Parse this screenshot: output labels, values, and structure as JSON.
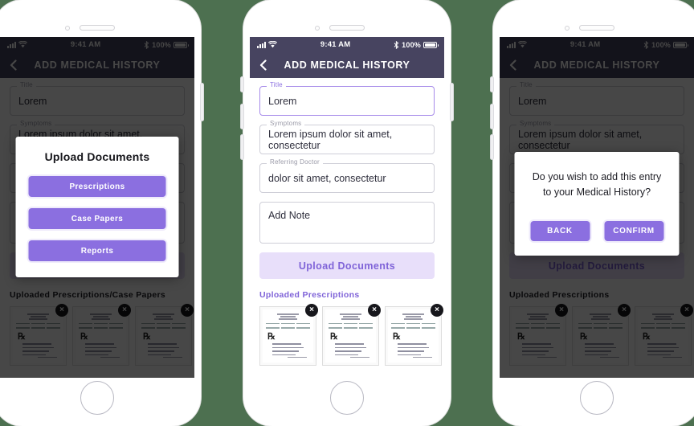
{
  "background_color": "#4d7050",
  "accent_purple": "#8b6fe0",
  "accent_light_purple": "#e8dffa",
  "navbar_color": "#474460",
  "status_bar": {
    "time": "9:41 AM",
    "battery_percent": "100%",
    "signal_icon": "signal-bars-icon",
    "wifi_icon": "wifi-icon",
    "bluetooth_icon": "bluetooth-icon",
    "battery_icon": "battery-icon"
  },
  "navbar": {
    "title": "ADD MEDICAL HISTORY",
    "back_icon": "back-chevron-icon"
  },
  "form": {
    "title_label": "Title",
    "title_value": "Lorem",
    "symptoms_label": "Symptoms",
    "symptoms_value": "Lorem ipsum dolor sit amet, consectetur",
    "referring_doctor_label": "Referring Doctor",
    "referring_doctor_value": "dolor sit amet, consectetur",
    "note_placeholder": "Add Note",
    "upload_button": "Upload Documents"
  },
  "sections": {
    "uploaded_prescriptions": "Uploaded Prescriptions",
    "uploaded_prescriptions_case_papers": "Uploaded Prescriptions/Case Papers"
  },
  "thumbnail": {
    "rx_symbol": "℞",
    "delete_icon": "×",
    "delete_icon_name": "remove-document-icon"
  },
  "upload_modal": {
    "title": "Upload Documents",
    "options": [
      {
        "label": "Prescriptions"
      },
      {
        "label": "Case Papers"
      },
      {
        "label": "Reports"
      }
    ]
  },
  "confirm_modal": {
    "message": "Do you wish to add this entry to your Medical History?",
    "back_label": "BACK",
    "confirm_label": "CONFIRM"
  }
}
